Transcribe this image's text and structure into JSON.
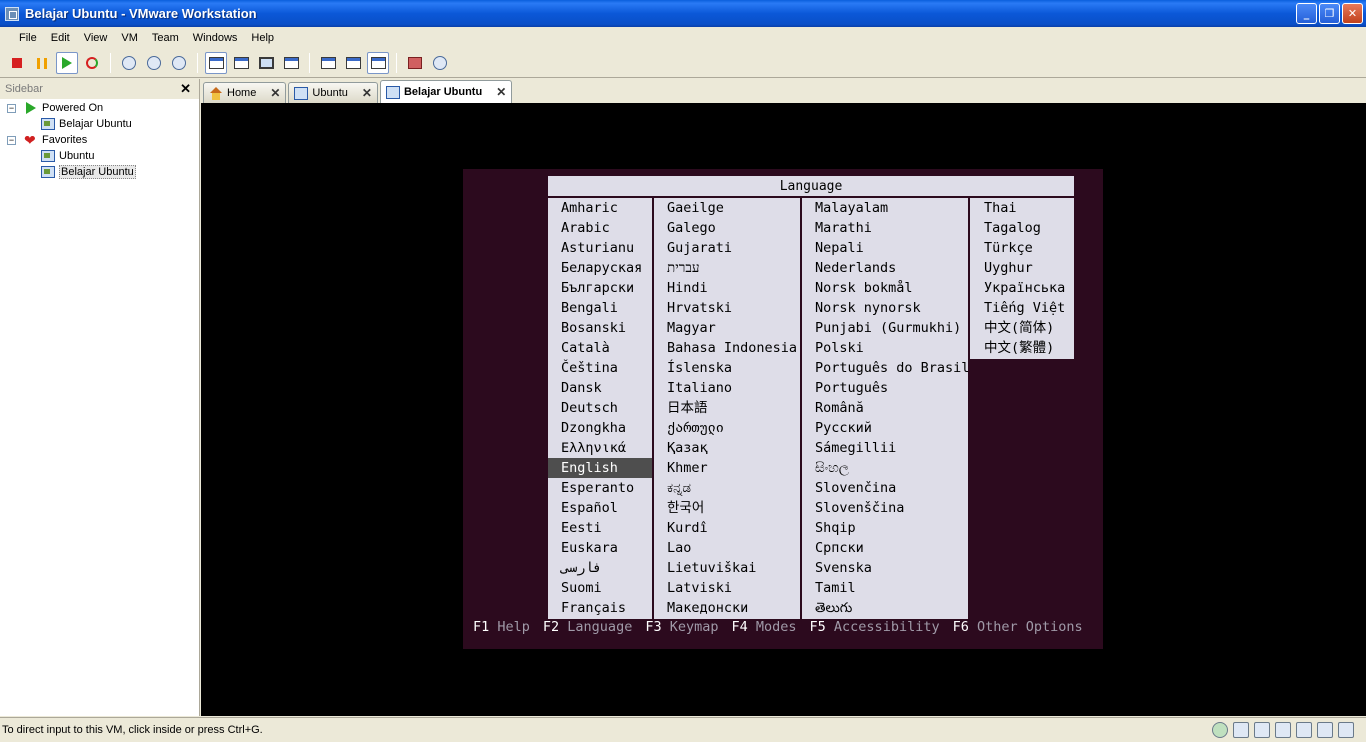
{
  "window": {
    "title": "Belajar Ubuntu - VMware Workstation",
    "controls": [
      "minimize",
      "restore",
      "close"
    ]
  },
  "menu": [
    "File",
    "Edit",
    "View",
    "VM",
    "Team",
    "Windows",
    "Help"
  ],
  "sidebar": {
    "title": "Sidebar",
    "groups": [
      {
        "label": "Powered On",
        "children": [
          "Belajar Ubuntu"
        ]
      },
      {
        "label": "Favorites",
        "children": [
          "Ubuntu",
          "Belajar Ubuntu"
        ]
      }
    ]
  },
  "tabs": [
    {
      "label": "Home"
    },
    {
      "label": "Ubuntu"
    },
    {
      "label": "Belajar Ubuntu",
      "active": true
    }
  ],
  "installer": {
    "title": "Language",
    "columns": [
      [
        "Amharic",
        "Arabic",
        "Asturianu",
        "Беларуская",
        "Български",
        "Bengali",
        "Bosanski",
        "Català",
        "Čeština",
        "Dansk",
        "Deutsch",
        "Dzongkha",
        "Ελληνικά",
        "English",
        "Esperanto",
        "Español",
        "Eesti",
        "Euskara",
        "فارسی",
        "Suomi",
        "Français"
      ],
      [
        "Gaeilge",
        "Galego",
        "Gujarati",
        "עברית",
        "Hindi",
        "Hrvatski",
        "Magyar",
        "Bahasa Indonesia",
        "Íslenska",
        "Italiano",
        "日本語",
        "ქართული",
        "Қазақ",
        "Khmer",
        "ಕನ್ನಡ",
        "한국어",
        "Kurdî",
        "Lao",
        "Lietuviškai",
        "Latviski",
        "Македонски"
      ],
      [
        "Malayalam",
        "Marathi",
        "Nepali",
        "Nederlands",
        "Norsk bokmål",
        "Norsk nynorsk",
        "Punjabi (Gurmukhi)",
        "Polski",
        "Português do Brasil",
        "Português",
        "Română",
        "Русский",
        "Sámegillii",
        "සිංහල",
        "Slovenčina",
        "Slovenščina",
        "Shqip",
        "Српски",
        "Svenska",
        "Tamil",
        "తెలుగు"
      ],
      [
        "Thai",
        "Tagalog",
        "Türkçe",
        "Uyghur",
        "Українська",
        "Tiếng Việt",
        "中文(简体)",
        "中文(繁體)"
      ]
    ],
    "selected": "English",
    "function_keys": [
      {
        "key": "F1",
        "label": "Help"
      },
      {
        "key": "F2",
        "label": "Language"
      },
      {
        "key": "F3",
        "label": "Keymap"
      },
      {
        "key": "F4",
        "label": "Modes"
      },
      {
        "key": "F5",
        "label": "Accessibility"
      },
      {
        "key": "F6",
        "label": "Other Options"
      }
    ]
  },
  "status": {
    "message": "To direct input to this VM, click inside or press Ctrl+G."
  }
}
